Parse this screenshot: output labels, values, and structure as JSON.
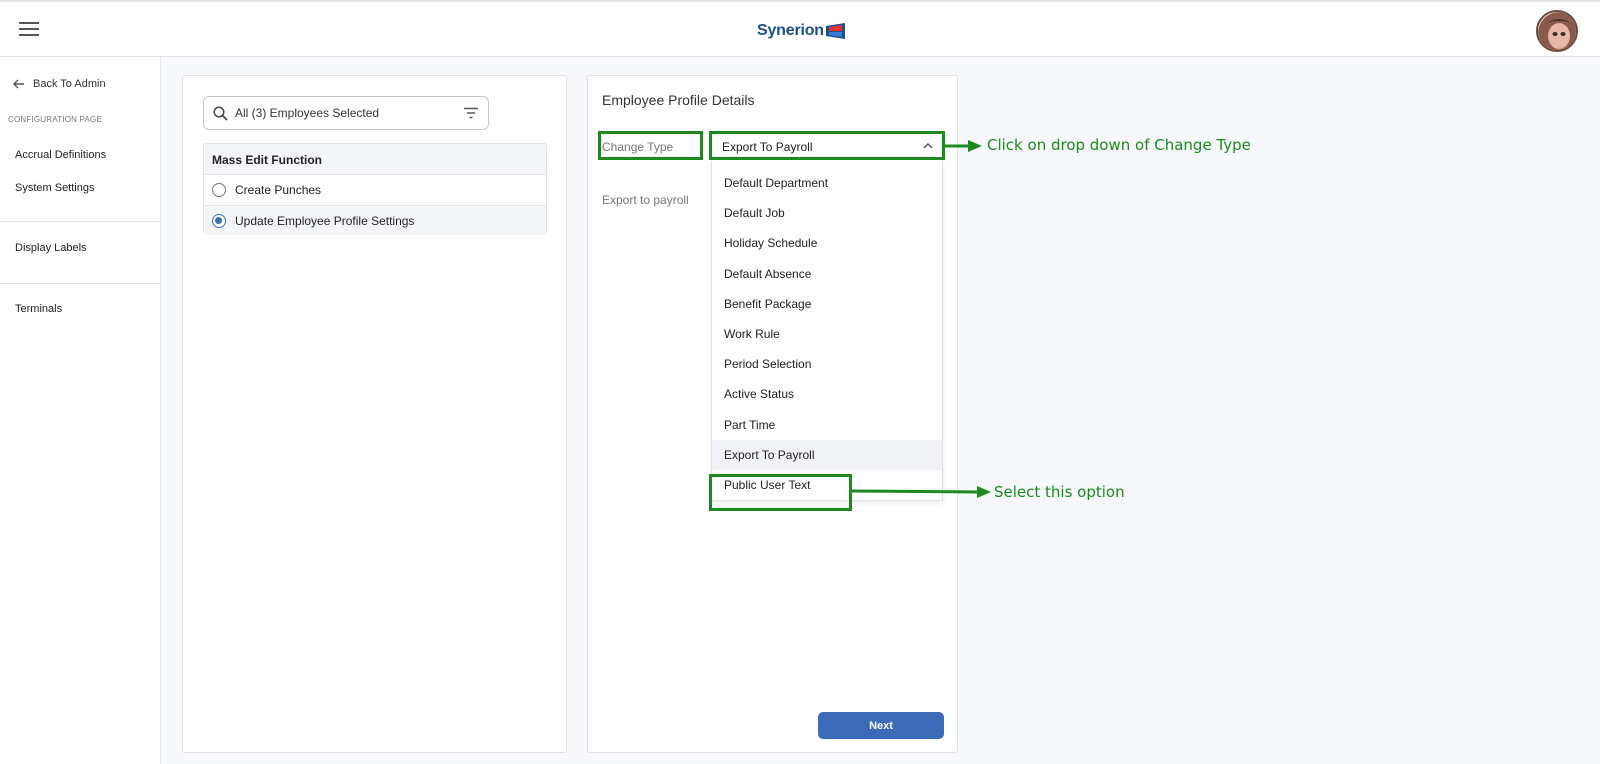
{
  "header": {
    "brand": "Synerion",
    "brand_colors": {
      "dark": "#1d4f8f",
      "red": "#e3342f",
      "blue": "#3a7bd5"
    }
  },
  "sidebar": {
    "back_label": "Back To Admin",
    "section_title": "CONFIGURATION PAGE",
    "items": [
      {
        "label": "Accrual Definitions"
      },
      {
        "label": "System Settings"
      },
      {
        "label": "Display Labels"
      },
      {
        "label": "Terminals"
      }
    ]
  },
  "left_panel": {
    "search_text": "All (3) Employees Selected",
    "mass_edit": {
      "heading": "Mass Edit Function",
      "options": [
        {
          "label": "Create Punches",
          "selected": false
        },
        {
          "label": "Update Employee Profile Settings",
          "selected": true
        }
      ]
    }
  },
  "right_panel": {
    "title": "Employee Profile Details",
    "change_type_label": "Change Type",
    "change_type_value": "Export To Payroll",
    "export_label": "Export to payroll",
    "dropdown_options": [
      "Default Department",
      "Default Job",
      "Holiday Schedule",
      "Default Absence",
      "Benefit Package",
      "Work Rule",
      "Period Selection",
      "Active Status",
      "Part Time",
      "Export To Payroll",
      "Public User Text"
    ],
    "selected_option": "Export To Payroll",
    "next_label": "Next"
  },
  "annotations": {
    "color": "#1c8a1c",
    "dropdown_note": "Click on drop down of Change Type",
    "option_note": "Select this option"
  }
}
